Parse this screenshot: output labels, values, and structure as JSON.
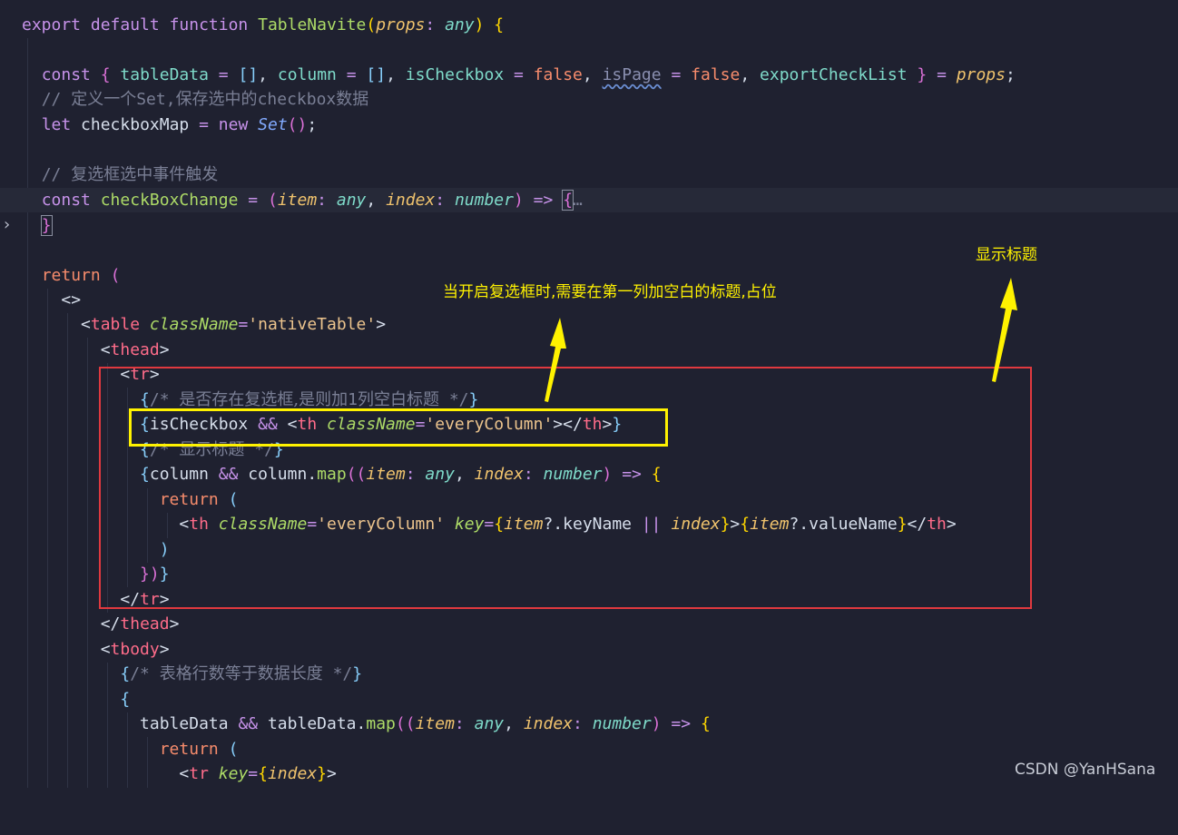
{
  "colors": {
    "background": "#1f2130",
    "highlight_box": "#e0393f",
    "annotation_box": "#fff200",
    "annotation_text": "#fff200"
  },
  "lines": {
    "l1": {
      "t1": "export",
      "t2": "default",
      "t3": "function",
      "t4": "TableNavite",
      "t5": "(",
      "t6": "props",
      "t7": ":",
      "t8": "any",
      "t9": ")",
      "t10": "{"
    },
    "l3": {
      "t1": "const",
      "t2": "{",
      "t3": "tableData",
      "t4": "=",
      "t5": "[]",
      "t6": ",",
      "t7": "column",
      "t8": "=",
      "t9": "[]",
      "t10": ",",
      "t11": "isCheckbox",
      "t12": "=",
      "t13": "false",
      "t14": ",",
      "t15": "isPage",
      "t16": "=",
      "t17": "false",
      "t18": ",",
      "t19": "exportCheckList",
      "t20": "}",
      "t21": "=",
      "t22": "props",
      "t23": ";"
    },
    "l4": {
      "t1": "// ",
      "t2": "定义一个",
      "t3": "Set,",
      "t4": "保存选中的",
      "t5": "checkbox",
      "t6": "数据"
    },
    "l5": {
      "t1": "let",
      "t2": "checkboxMap",
      "t3": "=",
      "t4": "new",
      "t5": "Set",
      "t6": "()",
      "t7": ";"
    },
    "l7": {
      "t1": "// ",
      "t2": "复选框选中事件触发"
    },
    "l8": {
      "t1": "const",
      "t2": "checkBoxChange",
      "t3": "=",
      "t4": "(",
      "t5": "item",
      "t6": ":",
      "t7": "any",
      "t8": ",",
      "t9": "index",
      "t10": ":",
      "t11": "number",
      "t12": ")",
      "t13": "=>",
      "t14": "{",
      "t15": "…"
    },
    "l9": {
      "t1": "}"
    },
    "l11": {
      "t1": "return",
      "t2": "("
    },
    "l12": {
      "t1": "<>"
    },
    "l13": {
      "t1": "<",
      "t2": "table",
      "t3": "className",
      "t4": "=",
      "t5": "'nativeTable'",
      "t6": ">"
    },
    "l14": {
      "t1": "<",
      "t2": "thead",
      "t3": ">"
    },
    "l15": {
      "t1": "<",
      "t2": "tr",
      "t3": ">"
    },
    "l16": {
      "t1": "{",
      "t2": "/* ",
      "t3": "是否存在复选框,是则加",
      "t4": "1",
      "t5": "列空白标题",
      "t6": " */",
      "t7": "}"
    },
    "l17": {
      "t1": "{",
      "t2": "isCheckbox",
      "t3": "&&",
      "t4": "<",
      "t5": "th",
      "t6": "className",
      "t7": "=",
      "t8": "'everyColumn'",
      "t9": "></",
      "t10": "th",
      "t11": ">",
      "t12": "}"
    },
    "l18": {
      "t1": "{",
      "t2": "/* ",
      "t3": "显示标题",
      "t4": " */",
      "t5": "}"
    },
    "l19": {
      "t1": "{",
      "t2": "column",
      "t3": "&&",
      "t4": "column",
      "t5": ".",
      "t6": "map",
      "t7": "((",
      "t8": "item",
      "t9": ":",
      "t10": "any",
      "t11": ",",
      "t12": "index",
      "t13": ":",
      "t14": "number",
      "t15": ")",
      "t16": "=>",
      "t17": "{"
    },
    "l20": {
      "t1": "return",
      "t2": "("
    },
    "l21": {
      "t1": "<",
      "t2": "th",
      "t3": "className",
      "t4": "=",
      "t5": "'everyColumn'",
      "t6": "key",
      "t7": "=",
      "t8": "{",
      "t9": "item",
      "t10": "?.",
      "t11": "keyName",
      "t12": "||",
      "t13": "index",
      "t14": "}",
      "t15": ">",
      "t16": "{",
      "t17": "item",
      "t18": "?.",
      "t19": "valueName",
      "t20": "}",
      "t21": "</",
      "t22": "th",
      "t23": ">"
    },
    "l22": {
      "t1": ")"
    },
    "l23": {
      "t1": "})",
      "t2": "}"
    },
    "l24": {
      "t1": "</",
      "t2": "tr",
      "t3": ">"
    },
    "l25": {
      "t1": "</",
      "t2": "thead",
      "t3": ">"
    },
    "l26": {
      "t1": "<",
      "t2": "tbody",
      "t3": ">"
    },
    "l27": {
      "t1": "{",
      "t2": "/* ",
      "t3": "表格行数等于数据长度",
      "t4": " */",
      "t5": "}"
    },
    "l28": {
      "t1": "{"
    },
    "l29": {
      "t1": "tableData",
      "t2": "&&",
      "t3": "tableData",
      "t4": ".",
      "t5": "map",
      "t6": "((",
      "t7": "item",
      "t8": ":",
      "t9": "any",
      "t10": ",",
      "t11": "index",
      "t12": ":",
      "t13": "number",
      "t14": ")",
      "t15": "=>",
      "t16": "{"
    },
    "l30": {
      "t1": "return",
      "t2": "("
    },
    "l31": {
      "t1": "<",
      "t2": "tr",
      "t3": "key",
      "t4": "=",
      "t5": "{",
      "t6": "index",
      "t7": "}",
      "t8": ">"
    }
  },
  "annotations": {
    "note_checkbox": "当开启复选框时,需要在第一列加空白的标题,占位",
    "note_title": "显示标题"
  },
  "watermark": "CSDN @YanHSana"
}
